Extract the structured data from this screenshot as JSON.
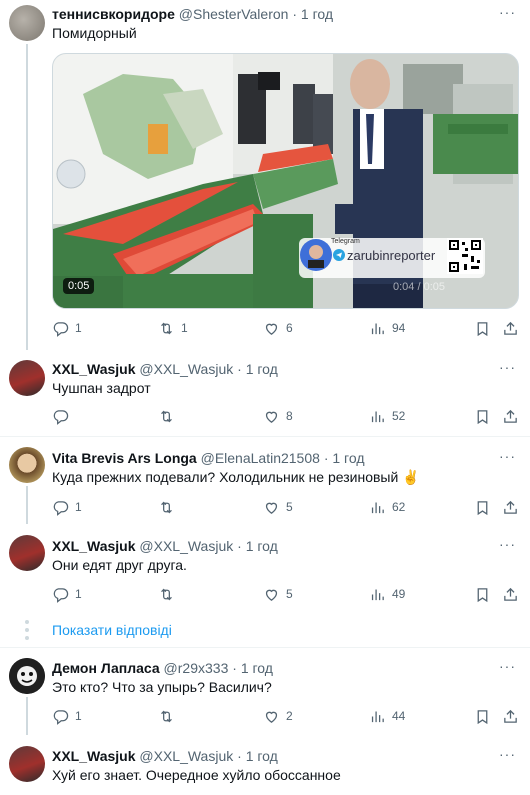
{
  "tweets": [
    {
      "name": "теннисвкоридоре",
      "handle": "@ShesterValeron",
      "sep": "·",
      "time": "1 год",
      "text": "Помидорный",
      "video": {
        "time": "0:05",
        "watermark_label": "Telegram",
        "watermark_name": "zarubinreporter",
        "overlay_time": "0:04 / 0:05"
      },
      "replies": "1",
      "retweets": "1",
      "likes": "6",
      "views": "94"
    },
    {
      "name": "XXL_Wasjuk",
      "handle": "@XXL_Wasjuk",
      "sep": "·",
      "time": "1 год",
      "text": "Чушпан задрот",
      "replies": "",
      "retweets": "",
      "likes": "8",
      "views": "52"
    },
    {
      "name": "Vita Brevis Ars Longa",
      "handle": "@ElenaLatin21508",
      "sep": "·",
      "time": "1 год",
      "text": "Куда прежних подевали? Холодильник не резиновый ✌️",
      "replies": "1",
      "retweets": "",
      "likes": "5",
      "views": "62"
    },
    {
      "name": "XXL_Wasjuk",
      "handle": "@XXL_Wasjuk",
      "sep": "·",
      "time": "1 год",
      "text": "Они едят друг друга.",
      "replies": "1",
      "retweets": "",
      "likes": "5",
      "views": "49"
    },
    {
      "name": "Демон Лапласа",
      "handle": "@r29x333",
      "sep": "·",
      "time": "1 год",
      "text": "Это кто? Что за упырь? Василич?",
      "replies": "1",
      "retweets": "",
      "likes": "2",
      "views": "44"
    },
    {
      "name": "XXL_Wasjuk",
      "handle": "@XXL_Wasjuk",
      "sep": "·",
      "time": "1 год",
      "text": "Хуй его знает. Очередное хуйло обоссанное"
    }
  ],
  "show_replies": "Показати відповіді",
  "more_label": "···",
  "icons": {
    "reply": "reply-icon",
    "retweet": "retweet-icon",
    "like": "heart-icon",
    "views": "views-icon",
    "bookmark": "bookmark-icon",
    "share": "share-icon"
  },
  "colors": {
    "link": "#1d9bf0",
    "muted": "#536471",
    "line": "#cfd9de"
  }
}
